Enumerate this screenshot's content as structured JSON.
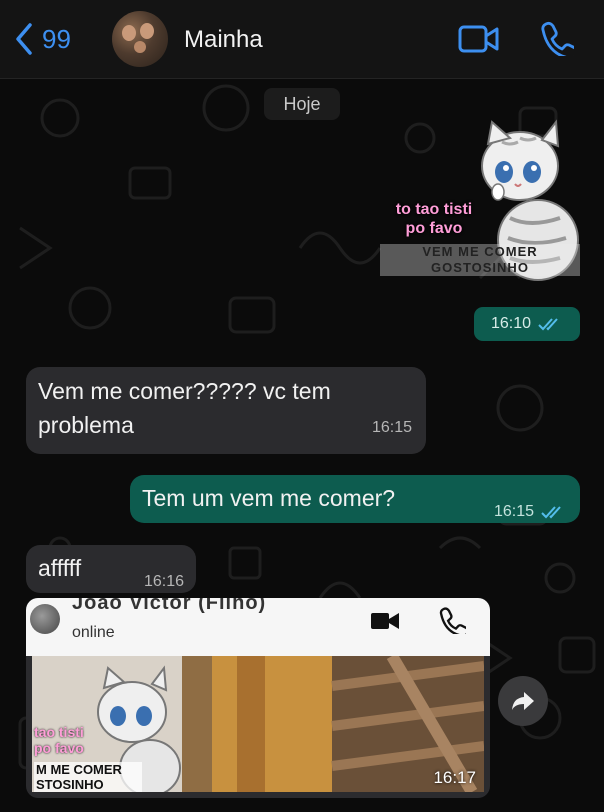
{
  "header": {
    "back_count": "99",
    "contact_name": "Mainha"
  },
  "chat": {
    "date_label": "Hoje",
    "sticker": {
      "text": "to tao tisti po favo",
      "banner": "VEM ME COMER GOSTOSINHO"
    },
    "sticker_time": "16:10",
    "messages": [
      {
        "direction": "in",
        "text": "Vem me comer????? vc tem problema",
        "time": "16:15"
      },
      {
        "direction": "out",
        "text": "Tem um vem me comer?",
        "time": "16:15",
        "read": true
      },
      {
        "direction": "in",
        "text": "afffff",
        "time": "16:16"
      }
    ],
    "forwarded": {
      "contact_name": "Joao Victor (Filho)",
      "status": "online",
      "caption_pink": "tao tisti po favo",
      "caption_banner": "M ME COMER STOSINHO",
      "time": "16:17"
    }
  },
  "colors": {
    "accent_blue": "#3d8ff0",
    "outgoing_bubble": "#0d5c4f",
    "incoming_bubble": "#2b2b2e",
    "read_ticks": "#53bdeb"
  }
}
